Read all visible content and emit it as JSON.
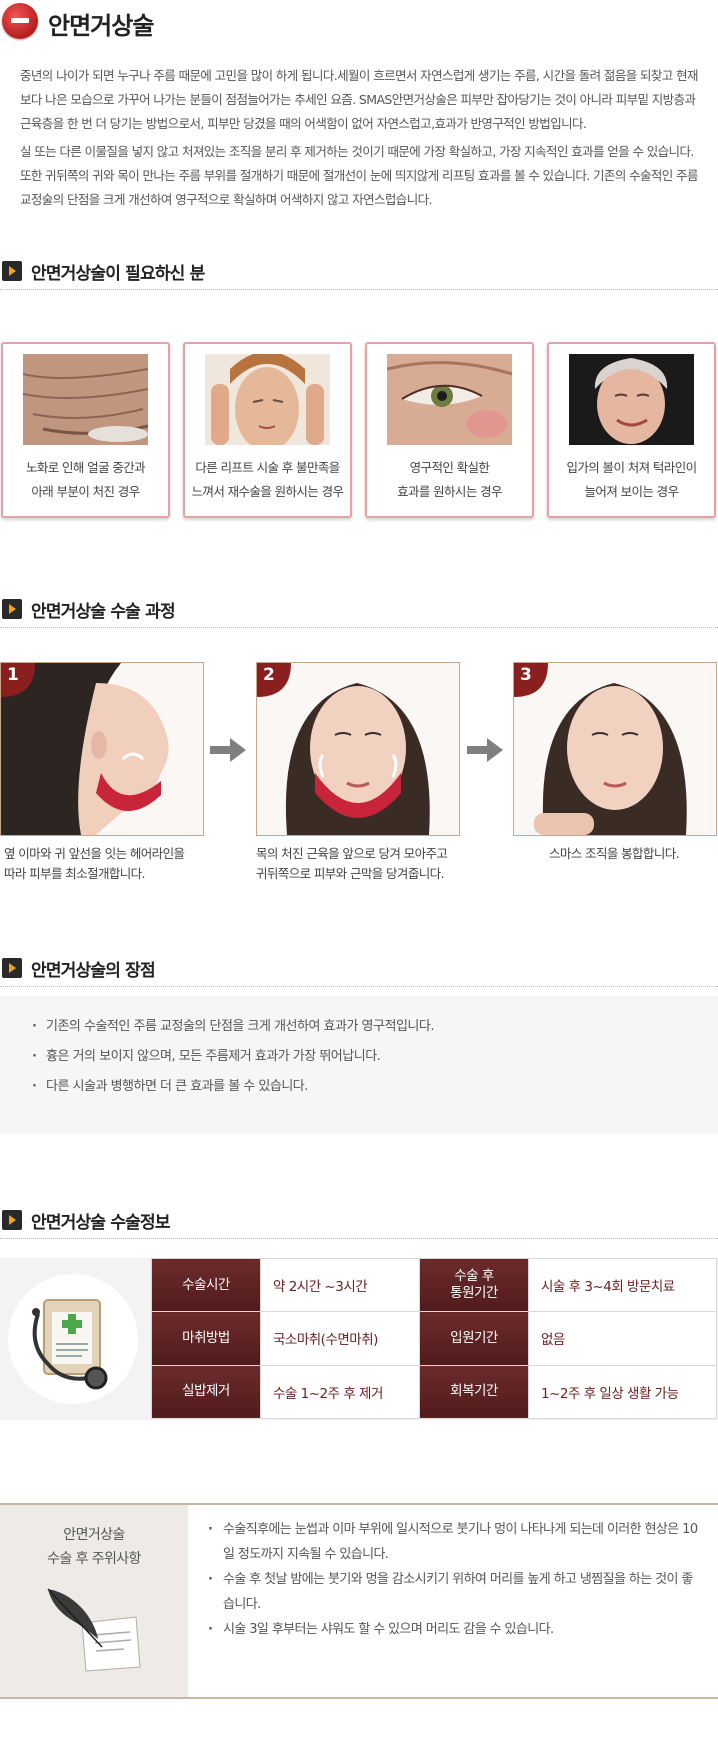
{
  "header": {
    "title": "안면거상술"
  },
  "intro": {
    "paragraphs": [
      "중년의 나이가 되면 누구나 주름 때문에 고민을 많이 하게 됩니다.세월이 흐르면서 자연스럽게 생기는 주름, 시간을 돌려 젊음을 되찾고 현재보다 나은 모습으로 가꾸어 나가는 분들이 점점늘어가는 추세인 요즘. SMAS안면거상술은 피부만 잡아당기는 것이 아니라 피부밑 지방층과근육층을 한 번 더 당기는 방법으로서, 피부만 당겼을 때의 어색함이 없어 자연스럽고,효과가 반영구적인 방법입니다.",
      "실 또는  다른 이물질을 넣지 않고 처져있는 조직을 분리 후 제거하는 것이기 때문에 가장 확실하고, 가장 지속적인 효과를 얻을 수 있습니다. 또한 귀뒤쪽의 귀와 목이 만나는 주름 부위를 절개하기 때문에 절개선이 눈에  띄지않게 리프팅 효과를 볼 수 있습니다. 기존의 수술적인 주름교정술의 단점을 크게 개선하여 영구적으로 확실하며 어색하지 않고 자연스럽습니다."
    ]
  },
  "sections": {
    "needs": "안면거상술이 필요하신 분",
    "process": "안면거상술 수술 과정",
    "advantages": "안면거상술의 장점",
    "info": "안면거상술 수술정보"
  },
  "needs": [
    {
      "line1": "노화로 인해 얼굴 중간과",
      "line2": "아래 부분이 처진 경우"
    },
    {
      "line1": "다른 리프트 시술 후 불만족을",
      "line2": "느껴서 재수술을 원하시는 경우"
    },
    {
      "line1": "영구적인 확실한",
      "line2": "효과를 원하시는 경우"
    },
    {
      "line1": "입가의 볼이 처져 턱라인이",
      "line2": "늘어져 보이는 경우"
    }
  ],
  "process": [
    {
      "num": "1",
      "line1": "옆 이마와 귀 앞선을 잇는 헤어라인을",
      "line2": "따라 피부를 최소절개합니다."
    },
    {
      "num": "2",
      "line1": "목의 처진 근육을 앞으로 당겨 모아주고",
      "line2": "귀뒤쪽으로 피부와 근막을 당겨줍니다."
    },
    {
      "num": "3",
      "line1": "스마스 조직을 봉합합니다.",
      "line2": ""
    }
  ],
  "advantages": [
    "기존의 수술적인 주름 교정술의 단점을 크게 개선하여 효과가 영구적입니다.",
    "흉은 거의 보이지 않으며, 모든 주름제거 효과가 가장 뛰어납니다.",
    "다른 시술과 병행하면 더 큰 효과를 볼 수 있습니다."
  ],
  "info_table": {
    "row1": {
      "h1": "수술시간",
      "v1": "약 2시간 ~3시간",
      "h2a": "수술 후",
      "h2b": "통원기간",
      "v2": "시술 후 3~4회 방문치료"
    },
    "row2": {
      "h1": "마취방법",
      "v1": "국소마취(수면마취)",
      "h2": "입원기간",
      "v2": "없음"
    },
    "row3": {
      "h1": "실밥제거",
      "v1": "수술 1~2주 후 제거",
      "h2": "회복기간",
      "v2": "1~2주 후 일상 생활 가능"
    }
  },
  "caution": {
    "title1": "안면거상술",
    "title2": "수술 후 주위사항",
    "items": [
      "수술직후에는 눈썹과 이마 부위에 일시적으로 붓기나 멍이 나타나게 되는데 이러한 현상은 10일 정도까지 지속될 수 있습니다.",
      "수술 후 첫날 밤에는 붓기와 멍을 감소시키기 위하여 머리를 높게 하고 냉찜질을 하는 것이 좋습니다.",
      "시술 3일 후부터는 샤워도 할 수 있으며 머리도 감을 수 있습니다."
    ]
  },
  "colors": {
    "accent_red": "#c62a2a",
    "card_border": "#e5a2a6",
    "table_header": "#5e2223",
    "table_value": "#6b2121"
  }
}
